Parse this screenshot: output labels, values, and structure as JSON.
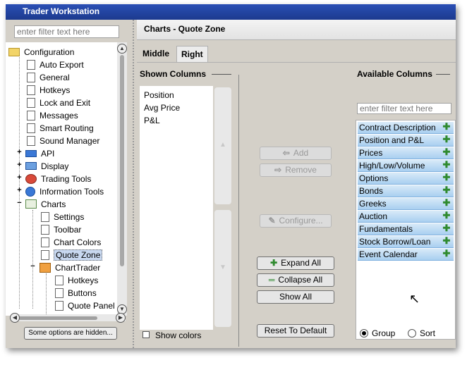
{
  "window": {
    "title": "Trader Workstation"
  },
  "left_panel": {
    "filter_placeholder": "enter filter text here",
    "tree": [
      {
        "label": "Configuration",
        "icon": "folder-icon"
      },
      {
        "label": "Auto Export",
        "icon": "page-icon"
      },
      {
        "label": "General",
        "icon": "page-icon"
      },
      {
        "label": "Hotkeys",
        "icon": "page-icon"
      },
      {
        "label": "Lock and Exit",
        "icon": "page-icon"
      },
      {
        "label": "Messages",
        "icon": "page-icon"
      },
      {
        "label": "Smart Routing",
        "icon": "page-icon"
      },
      {
        "label": "Sound Manager",
        "icon": "page-icon"
      },
      {
        "label": "API",
        "icon": "api-icon"
      },
      {
        "label": "Display",
        "icon": "display-icon"
      },
      {
        "label": "Trading Tools",
        "icon": "trading-tools-icon"
      },
      {
        "label": "Information Tools",
        "icon": "info-icon"
      },
      {
        "label": "Charts",
        "icon": "chart-icon"
      },
      {
        "label": "Settings",
        "icon": "page-icon"
      },
      {
        "label": "Toolbar",
        "icon": "page-icon"
      },
      {
        "label": "Chart Colors",
        "icon": "page-icon"
      },
      {
        "label": "Quote Zone",
        "icon": "page-icon"
      },
      {
        "label": "ChartTrader",
        "icon": "charttrader-icon"
      },
      {
        "label": "Hotkeys",
        "icon": "page-icon"
      },
      {
        "label": "Buttons",
        "icon": "page-icon"
      },
      {
        "label": "Quote Panel",
        "icon": "page-icon"
      }
    ],
    "hidden_button": "Some options are hidden..."
  },
  "header": {
    "title": "Charts - Quote Zone"
  },
  "tabs": [
    {
      "label": "Middle"
    },
    {
      "label": "Right"
    }
  ],
  "shown_columns": {
    "title": "Shown Columns",
    "items": [
      "Position",
      "Avg Price",
      "P&L"
    ],
    "show_colors_label": "Show colors"
  },
  "actions": {
    "add": "Add",
    "remove": "Remove",
    "configure": "Configure...",
    "expand_all": "Expand All",
    "collapse_all": "Collapse All",
    "show_all": "Show All",
    "reset": "Reset To Default"
  },
  "available_columns": {
    "title": "Available Columns",
    "filter_placeholder": "enter filter text here",
    "items": [
      "Contract Description",
      "Position and P&L",
      "Prices",
      "High/Low/Volume",
      "Options",
      "Bonds",
      "Greeks",
      "Auction",
      "Fundamentals",
      "Stock Borrow/Loan",
      "Event Calendar"
    ],
    "group_label": "Group",
    "sort_label": "Sort",
    "selected_mode": "Group"
  },
  "colors": {
    "selection": "#c8d8f0",
    "available_item": "#a9cff0",
    "add_icon": "#2f8a2f"
  }
}
